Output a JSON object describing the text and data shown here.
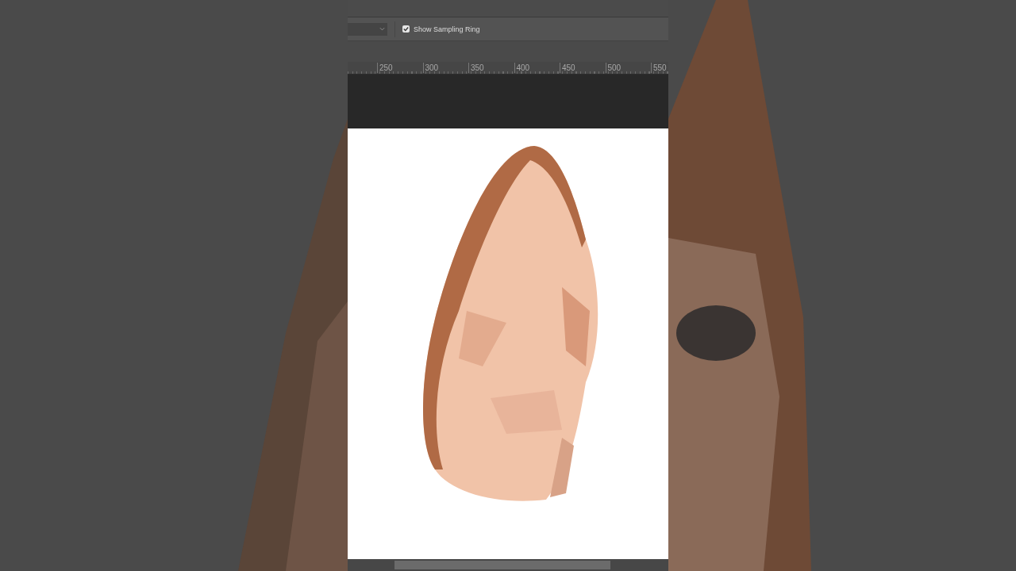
{
  "options_bar": {
    "sampling_ring": {
      "label": "Show Sampling Ring",
      "checked": true
    }
  },
  "ruler": {
    "ticks": [
      "250",
      "300",
      "350",
      "400",
      "450",
      "500",
      "550"
    ]
  }
}
